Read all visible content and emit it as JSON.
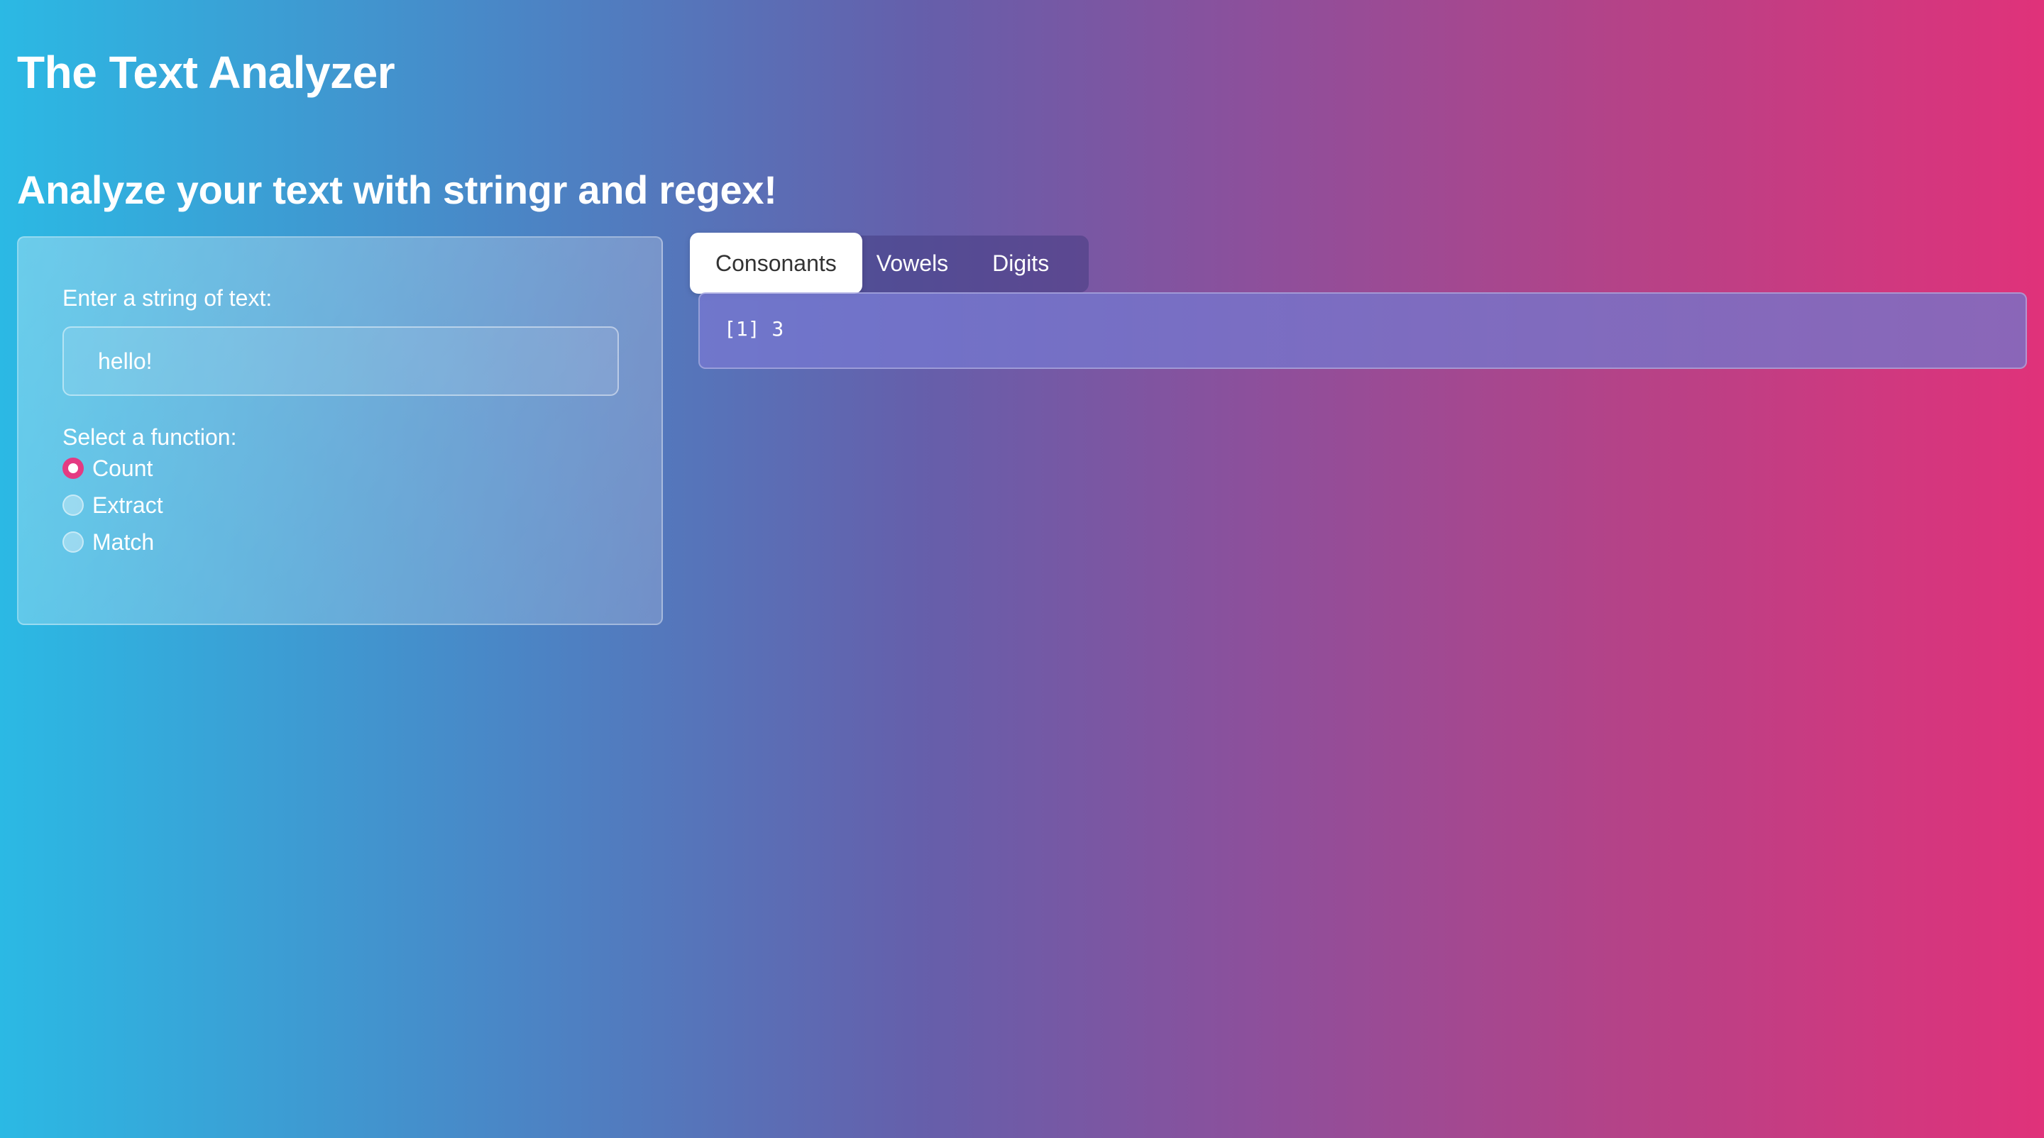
{
  "header": {
    "title": "The Text Analyzer",
    "subtitle": "Analyze your text with stringr and regex!"
  },
  "sidebar": {
    "input_label": "Enter a string of text:",
    "input_value": "hello!",
    "radio_label": "Select a function:",
    "options": [
      {
        "label": "Count",
        "selected": true
      },
      {
        "label": "Extract",
        "selected": false
      },
      {
        "label": "Match",
        "selected": false
      }
    ]
  },
  "main": {
    "tabs": [
      {
        "label": "Consonants",
        "active": true
      },
      {
        "label": "Vowels",
        "active": false
      },
      {
        "label": "Digits",
        "active": false
      }
    ],
    "output": "[1] 3"
  },
  "colors": {
    "gradient_start": "#2bb9e4",
    "gradient_end": "#e0327a",
    "radio_accent": "#e43a82"
  }
}
